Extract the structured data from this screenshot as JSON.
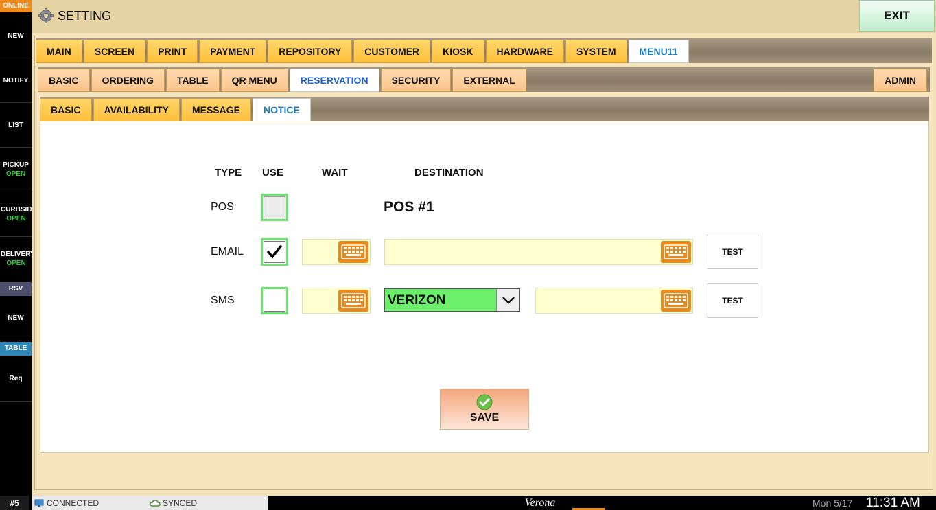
{
  "sidebar": {
    "online": "ONLINE",
    "items": [
      {
        "label": "NEW"
      },
      {
        "label": "NOTIFY"
      },
      {
        "label": "LIST"
      },
      {
        "label": "PICKUP",
        "sub": "OPEN"
      },
      {
        "label": "CURBSIDE",
        "sub": "OPEN"
      },
      {
        "label": "DELIVERY",
        "sub": "OPEN"
      }
    ],
    "rsv": "RSV",
    "rsv_new": "NEW",
    "table": "TABLE",
    "req": "Req",
    "colors": {
      "online": "#f08a1c",
      "rsv": "#4b4f6b",
      "table": "#2f86b5",
      "open": "#2ecc40"
    }
  },
  "header": {
    "title": "SETTING",
    "icon": "gear-icon",
    "exit_label": "EXIT"
  },
  "tabs_main": [
    {
      "label": "MAIN"
    },
    {
      "label": "SCREEN"
    },
    {
      "label": "PRINT"
    },
    {
      "label": "PAYMENT"
    },
    {
      "label": "REPOSITORY"
    },
    {
      "label": "CUSTOMER"
    },
    {
      "label": "KIOSK"
    },
    {
      "label": "HARDWARE"
    },
    {
      "label": "SYSTEM"
    },
    {
      "label": "MENU11",
      "active": true
    }
  ],
  "tabs_sub": [
    {
      "label": "BASIC"
    },
    {
      "label": "ORDERING"
    },
    {
      "label": "TABLE"
    },
    {
      "label": "QR MENU"
    },
    {
      "label": "RESERVATION",
      "active": true
    },
    {
      "label": "SECURITY"
    },
    {
      "label": "EXTERNAL"
    }
  ],
  "tab_admin": "ADMIN",
  "tabs_third": [
    {
      "label": "BASIC"
    },
    {
      "label": "AVAILABILITY"
    },
    {
      "label": "MESSAGE"
    },
    {
      "label": "NOTICE",
      "active": true
    }
  ],
  "notice": {
    "columns": {
      "type": "TYPE",
      "use": "USE",
      "wait": "WAIT",
      "destination": "DESTINATION"
    },
    "rows": {
      "pos": {
        "type": "POS",
        "checked": false,
        "destination": "POS #1"
      },
      "email": {
        "type": "EMAIL",
        "checked": true,
        "wait": "",
        "destination": "",
        "test": "TEST"
      },
      "sms": {
        "type": "SMS",
        "checked": false,
        "wait": "",
        "carrier": "VERIZON",
        "destination": "",
        "test": "TEST"
      }
    },
    "save_label": "SAVE"
  },
  "status": {
    "station": "#5",
    "connected": "CONNECTED",
    "synced": "SYNCED",
    "store": "Verona",
    "date": "Mon 5/17",
    "time": "11:31 AM"
  }
}
